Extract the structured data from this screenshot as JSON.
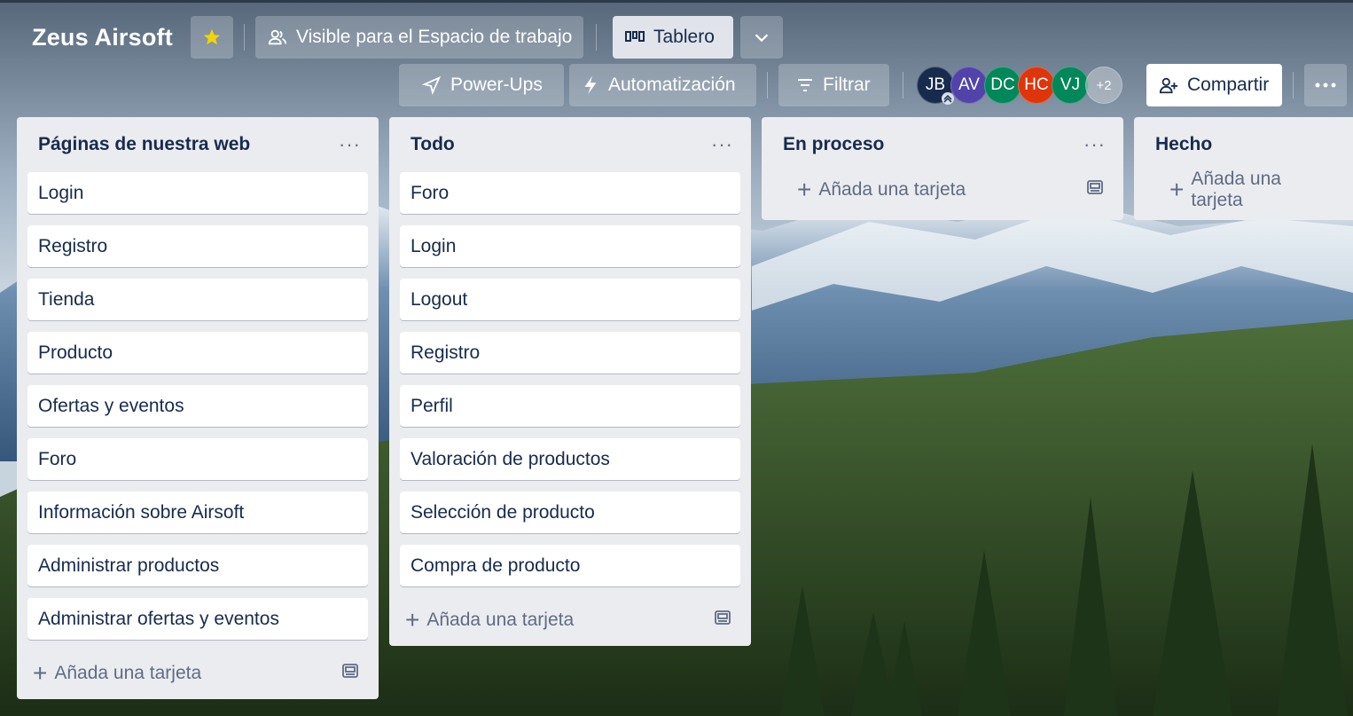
{
  "board": {
    "title": "Zeus Airsoft",
    "visibility_label": "Visible para el Espacio de trabajo",
    "view_label": "Tablero",
    "powerups_label": "Power-Ups",
    "automation_label": "Automatización",
    "filter_label": "Filtrar",
    "share_label": "Compartir",
    "members": [
      {
        "initials": "JB",
        "color": "#172b4d"
      },
      {
        "initials": "AV",
        "color": "#5243aa"
      },
      {
        "initials": "DC",
        "color": "#00875a"
      },
      {
        "initials": "HC",
        "color": "#de350b"
      },
      {
        "initials": "VJ",
        "color": "#00875a"
      }
    ],
    "members_more": "+2",
    "star_color": "#f2d600"
  },
  "lists": [
    {
      "title": "Páginas de nuestra web",
      "cards": [
        "Login",
        "Registro",
        "Tienda",
        "Producto",
        "Ofertas y eventos",
        "Foro",
        "Información sobre Airsoft",
        "Administrar productos",
        "Administrar ofertas y eventos"
      ],
      "add_label": "Añada una tarjeta"
    },
    {
      "title": "Todo",
      "cards": [
        "Foro",
        "Login",
        "Logout",
        "Registro",
        "Perfil",
        "Valoración de productos",
        "Selección de producto",
        "Compra de producto"
      ],
      "add_label": "Añada una tarjeta"
    },
    {
      "title": "En proceso",
      "cards": [],
      "add_label": "Añada una tarjeta"
    },
    {
      "title": "Hecho",
      "cards": [],
      "add_label": "Añada una tarjeta"
    }
  ]
}
